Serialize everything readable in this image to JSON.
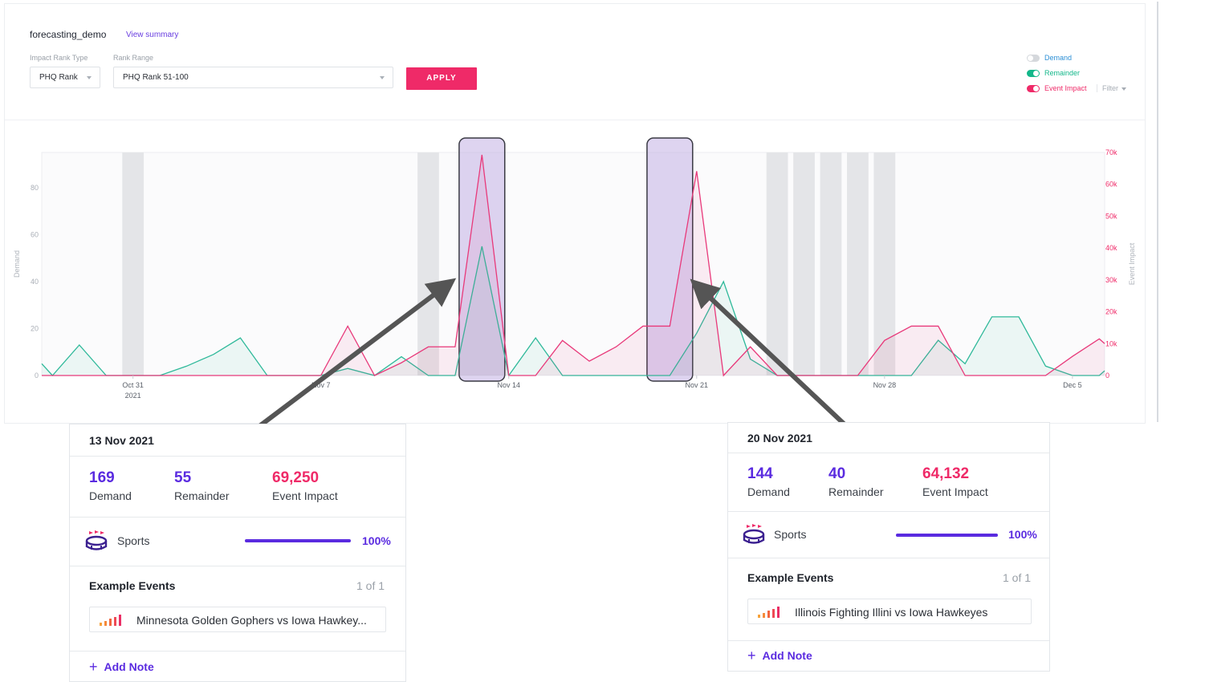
{
  "header": {
    "title": "forecasting_demo",
    "view_summary": "View summary"
  },
  "filters": {
    "impact_rank_type_label": "Impact Rank Type",
    "impact_rank_type_value": "PHQ Rank",
    "rank_range_label": "Rank Range",
    "rank_range_value": "PHQ Rank 51-100",
    "apply_label": "APPLY"
  },
  "legend": {
    "items": [
      {
        "label": "Demand",
        "color": "#2b8fd6",
        "on": false
      },
      {
        "label": "Remainder",
        "color": "#13b78a",
        "on": true
      },
      {
        "label": "Event Impact",
        "color": "#ef2a68",
        "on": true
      }
    ],
    "filter_label": "Filter"
  },
  "chart_data": {
    "type": "line",
    "left_axis": {
      "label": "Demand",
      "ticks": [
        "0",
        "20",
        "40",
        "60",
        "80"
      ],
      "ylim": [
        0,
        95
      ]
    },
    "right_axis": {
      "label": "Event Impact",
      "ticks": [
        "0",
        "10k",
        "20k",
        "30k",
        "40k",
        "50k",
        "60k",
        "70k"
      ],
      "ylim": [
        0,
        70000
      ]
    },
    "x_ticks": [
      {
        "label": "Oct 31",
        "sub": "2021",
        "day": 0
      },
      {
        "label": "Nov 7",
        "sub": "",
        "day": 7
      },
      {
        "label": "Nov 14",
        "sub": "",
        "day": 14
      },
      {
        "label": "Nov 21",
        "sub": "",
        "day": 21
      },
      {
        "label": "Nov 28",
        "sub": "",
        "day": 28
      },
      {
        "label": "Dec 5",
        "sub": "",
        "day": 35
      }
    ],
    "x_range_days": [
      -3.4,
      36.2
    ],
    "shaded_days": [
      [
        -0.4,
        0.4
      ],
      [
        10.6,
        11.4
      ],
      [
        23.6,
        24.4
      ],
      [
        24.6,
        25.4
      ],
      [
        25.6,
        26.4
      ],
      [
        26.6,
        27.4
      ],
      [
        27.6,
        28.4
      ]
    ],
    "highlight_days": [
      13,
      20
    ],
    "series": [
      {
        "name": "Remainder",
        "color": "#2fb99a",
        "axis": "left",
        "x": [
          -3.4,
          -3,
          -2,
          -1,
          0,
          1,
          2,
          3,
          4,
          5,
          6,
          7,
          8,
          9,
          10,
          11,
          12,
          13,
          14,
          15,
          16,
          17,
          18,
          19,
          20,
          21,
          22,
          23,
          24,
          25,
          26,
          27,
          28,
          29,
          30,
          31,
          32,
          33,
          34,
          35,
          36,
          36.2
        ],
        "y": [
          5,
          0,
          13,
          0,
          0,
          0,
          4,
          9,
          16,
          0,
          0,
          0,
          3,
          0,
          8,
          0,
          0,
          55,
          0,
          16,
          0,
          0,
          0,
          0,
          0,
          18,
          40,
          7,
          0,
          0,
          0,
          0,
          0,
          0,
          15,
          5,
          25,
          25,
          4,
          0,
          0,
          2
        ]
      },
      {
        "name": "Event Impact",
        "color": "#e8397a",
        "axis": "right",
        "x": [
          -3.4,
          -3,
          -2,
          -1,
          0,
          1,
          2,
          3,
          4,
          5,
          6,
          7,
          8,
          9,
          10,
          11,
          12,
          13,
          14,
          15,
          16,
          17,
          18,
          19,
          20,
          21,
          22,
          23,
          24,
          25,
          26,
          27,
          28,
          29,
          30,
          31,
          32,
          33,
          34,
          35,
          36,
          36.2
        ],
        "y": [
          0,
          0,
          0,
          0,
          0,
          0,
          0,
          0,
          0,
          0,
          0,
          0,
          15500,
          0,
          4000,
          9000,
          9000,
          69250,
          0,
          0,
          11000,
          4500,
          9000,
          15500,
          15500,
          64132,
          0,
          9000,
          0,
          0,
          0,
          0,
          11000,
          15500,
          15500,
          0,
          0,
          0,
          0,
          6000,
          11500,
          10000
        ]
      }
    ]
  },
  "cards": [
    {
      "date": "13 Nov 2021",
      "demand_value": "169",
      "demand_label": "Demand",
      "remainder_value": "55",
      "remainder_label": "Remainder",
      "impact_value": "69,250",
      "impact_label": "Event Impact",
      "category": "Sports",
      "category_pct": "100%",
      "category_fraction": 1.0,
      "examples_title": "Example Events",
      "examples_count": "1 of 1",
      "event_name": "Minnesota Golden Gophers vs Iowa Hawkey...",
      "add_note": "Add Note"
    },
    {
      "date": "20 Nov 2021",
      "demand_value": "144",
      "demand_label": "Demand",
      "remainder_value": "40",
      "remainder_label": "Remainder",
      "impact_value": "64,132",
      "impact_label": "Event Impact",
      "category": "Sports",
      "category_pct": "100%",
      "category_fraction": 1.0,
      "examples_title": "Example Events",
      "examples_count": "1 of 1",
      "event_name": "Illinois Fighting Illini vs Iowa Hawkeyes",
      "add_note": "Add Note"
    }
  ],
  "colors": {
    "demand_purple": "#5a2be0",
    "impact_pink": "#ef2a68",
    "remainder_green": "#13b78a",
    "highlight": "#d8cfee"
  }
}
